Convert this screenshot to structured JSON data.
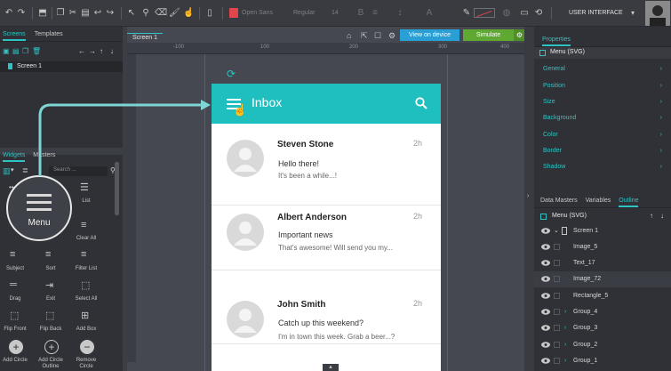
{
  "toolbar": {
    "font_family": "Open Sans",
    "font_weight": "Regular",
    "font_size": "14",
    "mode_label": "USER INTERFACE"
  },
  "left": {
    "tabs": [
      "Screens",
      "Templates"
    ],
    "screen_item": "Screen 1",
    "widget_tabs": [
      "Widgets",
      "Masters"
    ],
    "search_placeholder": "Search ...",
    "widgets": [
      {
        "label": "List"
      },
      {
        "label": "Clear All"
      },
      {
        "label": "Subject"
      },
      {
        "label": "Sort"
      },
      {
        "label": "Filter List"
      },
      {
        "label": "Drag"
      },
      {
        "label": "Exit"
      },
      {
        "label": "Select All"
      },
      {
        "label": "Flip Front"
      },
      {
        "label": "Flip Back"
      },
      {
        "label": "Add Box"
      },
      {
        "label": "Add Circle"
      },
      {
        "label": "Add Circle Outline"
      },
      {
        "label": "Remove Circle"
      }
    ],
    "magnifier_label": "Menu"
  },
  "canvas": {
    "tab": "Screen 1",
    "view_on_device": "View on device",
    "simulate": "Simulate",
    "ruler_label": "-100",
    "ruler_ticks": [
      "-100",
      "100",
      "200",
      "300",
      "400"
    ],
    "app": {
      "title": "Inbox",
      "messages": [
        {
          "name": "Steven Stone",
          "time": "2h",
          "subject": "Hello there!",
          "preview": "It's been a while...!"
        },
        {
          "name": "Albert Anderson",
          "time": "2h",
          "subject": "Important news",
          "preview": "That's awesome! Will send you my..."
        },
        {
          "name": "John Smith",
          "time": "2h",
          "subject": "Catch up this weekend?",
          "preview": "I'm in town this week. Grab a beer...?"
        }
      ]
    }
  },
  "right": {
    "tabs": [
      "Properties"
    ],
    "selected": "Menu (SVG)",
    "properties": [
      "General",
      "Position",
      "Size",
      "Background",
      "Color",
      "Border",
      "Shadow"
    ],
    "bottom_tabs": [
      "Data Masters",
      "Variables",
      "Outline"
    ],
    "outline_selected": "Menu (SVG)",
    "outline": [
      "Screen 1",
      "Image_5",
      "Text_17",
      "Image_72",
      "Rectangle_5",
      "Group_4",
      "Group_3",
      "Group_2",
      "Group_1"
    ]
  },
  "colors": {
    "accent": "#1fbfbf",
    "simulate": "#5fa832",
    "view_btn": "#2a9fd6"
  }
}
